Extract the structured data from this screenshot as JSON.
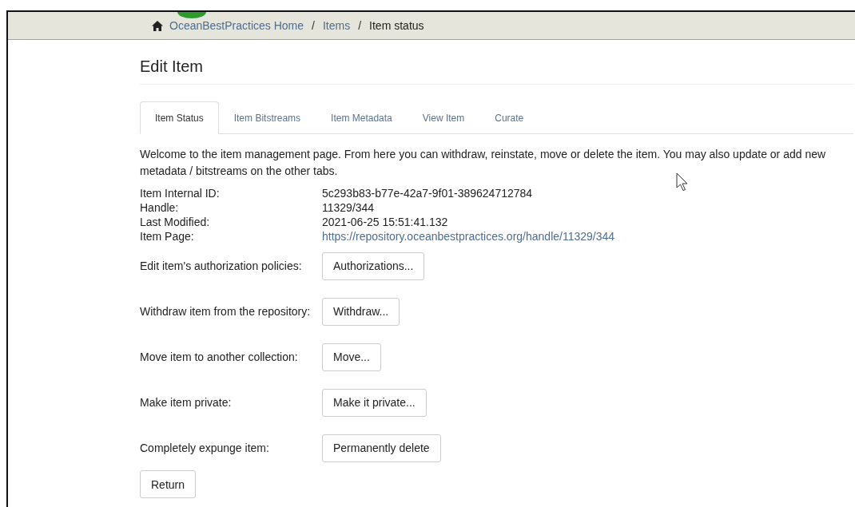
{
  "breadcrumb_separator": "/",
  "breadcrumb": [
    {
      "label": "OceanBestPractices Home",
      "kind": "link"
    },
    {
      "label": "Items",
      "kind": "link"
    },
    {
      "label": "Item status",
      "kind": "current"
    }
  ],
  "heading": "Edit Item",
  "tabs": [
    {
      "label": "Item Status",
      "selected": true
    },
    {
      "label": "Item Bitstreams",
      "selected": false
    },
    {
      "label": "Item Metadata",
      "selected": false
    },
    {
      "label": "View Item",
      "selected": false
    },
    {
      "label": "Curate",
      "selected": false
    }
  ],
  "intro": "Welcome to the item management page. From here you can withdraw, reinstate, move or delete the item. You may also update or add new metadata / bitstreams on the other tabs.",
  "details": [
    {
      "label": "Item Internal ID:",
      "value": "5c293b83-b77e-42a7-9f01-389624712784",
      "kind": "text"
    },
    {
      "label": "Handle:",
      "value": "11329/344",
      "kind": "text"
    },
    {
      "label": "Last Modified:",
      "value": "2021-06-25 15:51:41.132",
      "kind": "text"
    },
    {
      "label": "Item Page:",
      "value": "https://repository.oceanbestpractices.org/handle/11329/344",
      "kind": "link"
    }
  ],
  "actions": [
    {
      "label": "Edit item's authorization policies:",
      "button": "Authorizations..."
    },
    {
      "label": "Withdraw item from the repository:",
      "button": "Withdraw..."
    },
    {
      "label": "Move item to another collection:",
      "button": "Move..."
    },
    {
      "label": "Make item private:",
      "button": "Make it private..."
    },
    {
      "label": "Completely expunge item:",
      "button": "Permanently delete"
    }
  ],
  "return_button": "Return"
}
